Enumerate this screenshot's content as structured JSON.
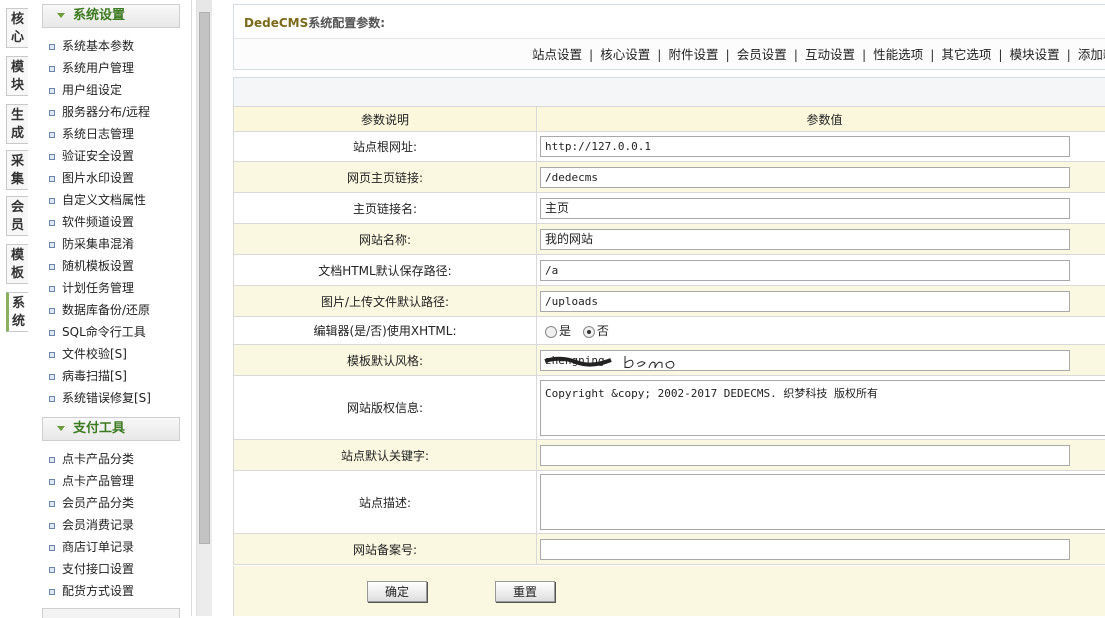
{
  "vtabs": [
    "核心",
    "模块",
    "生成",
    "采集",
    "会员",
    "模板",
    "系统"
  ],
  "menu": {
    "sections": [
      {
        "title": "系统设置",
        "items": [
          "系统基本参数",
          "系统用户管理",
          "用户组设定",
          "服务器分布/远程",
          "系统日志管理",
          "验证安全设置",
          "图片水印设置",
          "自定义文档属性",
          "软件频道设置",
          "防采集串混淆",
          "随机模板设置",
          "计划任务管理",
          "数据库备份/还原",
          "SQL命令行工具",
          "文件校验[S]",
          "病毒扫描[S]",
          "系统错误修复[S]"
        ]
      },
      {
        "title": "支付工具",
        "items": [
          "点卡产品分类",
          "点卡产品管理",
          "会员产品分类",
          "会员消费记录",
          "商店订单记录",
          "支付接口设置",
          "配货方式设置"
        ]
      }
    ]
  },
  "header": {
    "title_brand": "DedeCMS",
    "title_rest": "系统配置参数:",
    "tabs": [
      "站点设置",
      "核心设置",
      "附件设置",
      "会员设置",
      "互动设置",
      "性能选项",
      "其它选项",
      "模块设置",
      "添加新变"
    ]
  },
  "table": {
    "col_label": "参数说明",
    "col_value": "参数值",
    "rows": {
      "basehost": {
        "label": "站点根网址:",
        "value": "http://127.0.0.1"
      },
      "indexurl": {
        "label": "网页主页链接:",
        "value": "/dedecms"
      },
      "indexname": {
        "label": "主页链接名:",
        "value": "主页"
      },
      "webname": {
        "label": "网站名称:",
        "value": "我的网站"
      },
      "arcdir": {
        "label": "文档HTML默认保存路径:",
        "value": "/a"
      },
      "medias": {
        "label": "图片/上传文件默认路径:",
        "value": "/uploads"
      },
      "xhtml": {
        "label": "编辑器(是/否)使用XHTML:",
        "opt_yes": "是",
        "opt_no": "否",
        "selected": "否"
      },
      "style": {
        "label": "模板默认风格:",
        "value": "zhengning",
        "handwritten": "demo"
      },
      "powerby": {
        "label": "网站版权信息:",
        "value": "Copyright &copy; 2002-2017 DEDECMS. 织梦科技 版权所有"
      },
      "keywords": {
        "label": "站点默认关键字:",
        "value": ""
      },
      "description": {
        "label": "站点描述:",
        "value": ""
      },
      "beian": {
        "label": "网站备案号:",
        "value": ""
      }
    }
  },
  "buttons": {
    "confirm": "确定",
    "reset": "重置"
  }
}
